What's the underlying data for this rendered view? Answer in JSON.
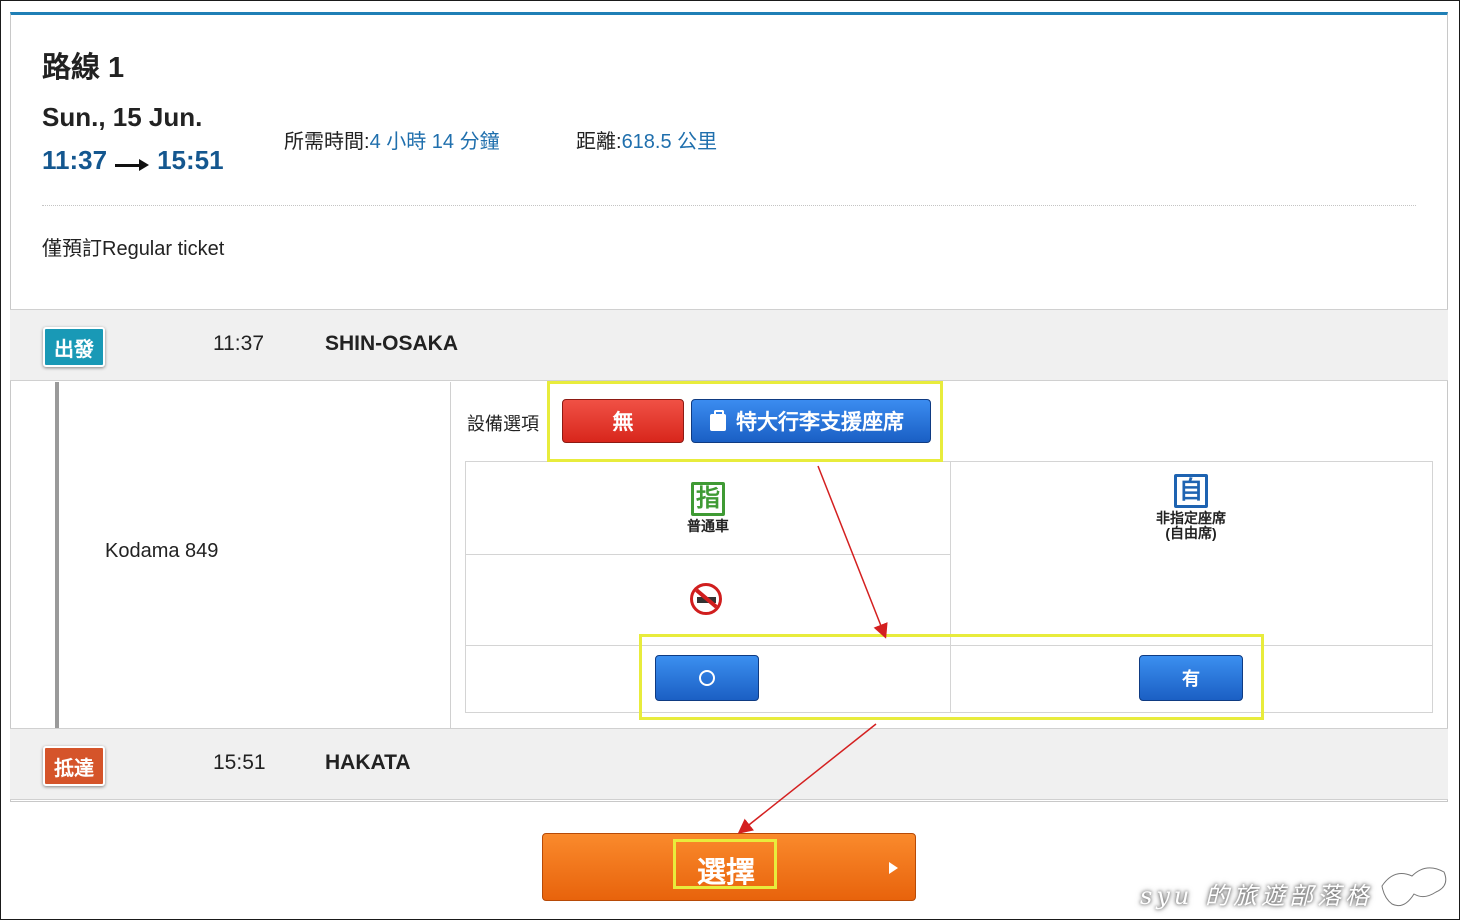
{
  "route": {
    "title": "路線 1",
    "date": "Sun., 15 Jun.",
    "depart_time": "11:37",
    "arrive_time": "15:51",
    "duration_label": "所需時間:",
    "duration_value": "4 小時 14 分鐘",
    "distance_label": "距離:",
    "distance_value": "618.5 公里",
    "note": "僅預訂Regular ticket"
  },
  "departure": {
    "badge": "出發",
    "time": "11:37",
    "station": "SHIN-OSAKA"
  },
  "arrival": {
    "badge": "抵達",
    "time": "15:51",
    "station": "HAKATA"
  },
  "train": {
    "name": "Kodama 849"
  },
  "equipment": {
    "label": "設備選項",
    "options": [
      "無",
      "特大行李支援座席"
    ]
  },
  "seats": {
    "reserved": {
      "icon_char": "指",
      "label": "普通車",
      "availability": "○",
      "icon": "no-smoking-icon"
    },
    "non_reserved": {
      "icon_char": "自",
      "label_line1": "非指定座席",
      "label_line2": "(自由席)",
      "availability": "有"
    }
  },
  "actions": {
    "select_label": "選擇"
  },
  "watermark": {
    "text": "syu 的旅遊部落格"
  },
  "colors": {
    "accent_blue": "#1f7fb6",
    "time_blue": "#14578f",
    "depart_badge": "#1999b6",
    "arrive_badge": "#d5542a",
    "none_button": "#d8261c",
    "luggage_button": "#1a5fc4",
    "select_button": "#e8630c",
    "highlight": "#e8ec3c",
    "annotation_arrow": "#d42020"
  }
}
